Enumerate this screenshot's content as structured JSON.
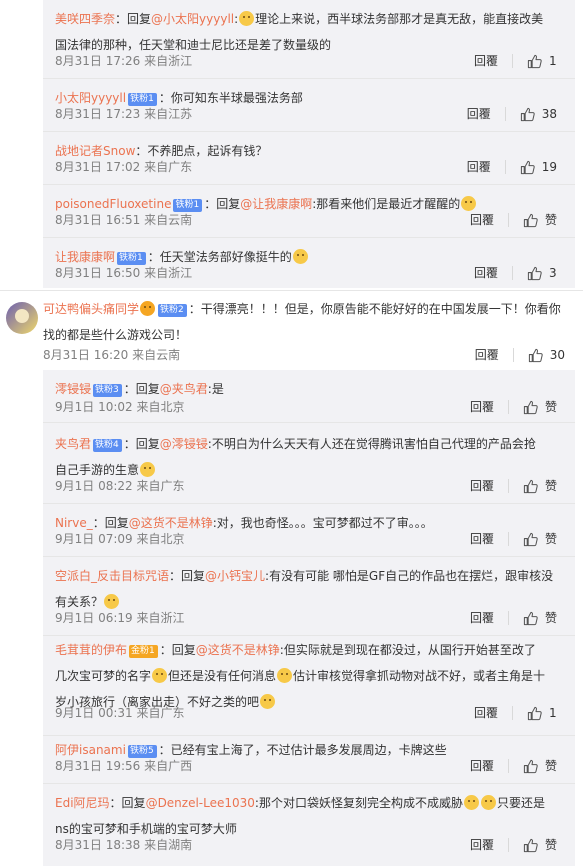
{
  "labels": {
    "reply": "回覆",
    "via": "来自"
  },
  "badges": {
    "b1": "铁粉1",
    "b2": "铁粉2",
    "b3": "铁粉3",
    "b4": "铁粉4",
    "b5": "铁粉5",
    "g1": "金粉1"
  },
  "group1": [
    {
      "user": "美咲四季奈",
      "prefix": "：回复",
      "mention": "@小太阳yyyyll",
      "text1": "理论上来说，西半球法务部那才是真无敌，能直接改美",
      "text2": "国法律的那种，任天堂和迪士尼比还是差了数量级的",
      "time": "8月31日 17:26",
      "loc": "来自浙江",
      "likes": "1"
    },
    {
      "user": "小太阳yyyyll",
      "text1": "：你可知东半球最强法务部",
      "time": "8月31日 17:23",
      "loc": "来自江苏",
      "likes": "38"
    },
    {
      "user": "战地记者Snow",
      "text1": "：不养肥点，起诉有钱？",
      "time": "8月31日 17:02",
      "loc": "来自广东",
      "likes": "19"
    },
    {
      "user": "poisonedFluoxetine",
      "prefix": "：回复",
      "mention": "@让我康康啊",
      "text1": ":那看来他们是最近才醒醒的",
      "time": "8月31日 16:51",
      "loc": "来自云南",
      "likes": "赞"
    },
    {
      "user": "让我康康啊",
      "text1": "：任天堂法务部好像挺牛的",
      "time": "8月31日 16:50",
      "loc": "来自浙江",
      "likes": "3"
    }
  ],
  "main": {
    "user": "可达鸭偏头痛同学",
    "text1": "：干得漂亮！！！但是，你原告能不能好好的在中国发展一下！你看你",
    "text2": "找的都是些什么游戏公司！",
    "time": "8月31日 16:20",
    "loc": "来自云南",
    "likes": "30"
  },
  "group2": [
    {
      "user": "澪锓锓",
      "prefix": "：回复",
      "mention": "@夹鸟君",
      "text1": ":是",
      "time": "9月1日 10:02",
      "loc": "来自北京",
      "likes": "赞"
    },
    {
      "user": "夹鸟君",
      "prefix": "：回复",
      "mention": "@澪锓锓",
      "text1": ":不明白为什么天天有人还在觉得腾讯害怕自己代理的产品会抢",
      "text2": "自己手游的生意",
      "time": "9月1日 08:22",
      "loc": "来自广东",
      "likes": "赞"
    },
    {
      "user": "Nirve_",
      "prefix": "：回复",
      "mention": "@这货不是林铮",
      "text1": ":对，我也奇怪。。。宝可梦都过不了审。。。",
      "time": "9月1日 07:09",
      "loc": "来自北京",
      "likes": "赞"
    },
    {
      "user": "空派白_反击目标咒语",
      "prefix": "：回复",
      "mention": "@小钙宝儿",
      "text1": ":有没有可能 哪怕是GF自己的作品也在摆烂，跟审核没",
      "text2": "有关系？",
      "time": "9月1日 06:19",
      "loc": "来自浙江",
      "likes": "赞"
    },
    {
      "user": "毛茸茸的伊布",
      "prefix": "：回复",
      "mention": "@这货不是林铮",
      "text1": ":但实际就是到现在都没过，从国行开始甚至改了",
      "text2": "几次宝可梦的名字",
      "text2b": "但还是没有任何消息",
      "text2c": "估计审核觉得拿抓动物对战不好，或者主角是十",
      "text3": "岁小孩旅行（离家出走）不好之类的吧",
      "time": "9月1日 00:31",
      "loc": "来自广东",
      "likes": "1"
    },
    {
      "user": "阿伊isanami",
      "text1": "：已经有宝上海了，不过估计最多发展周边，卡牌这些",
      "time": "8月31日 19:56",
      "loc": "来自广西",
      "likes": "赞"
    },
    {
      "user": "Edi阿尼玛",
      "prefix": "：回复",
      "mention": "@Denzel-Lee1030",
      "text1": ":那个对口袋妖怪复刻完全构成不成威胁",
      "text1b": "只要还是",
      "text2": "ns的宝可梦和手机端的宝可梦大师",
      "time": "8月31日 18:38",
      "loc": "来自湖南",
      "likes": "赞"
    }
  ]
}
